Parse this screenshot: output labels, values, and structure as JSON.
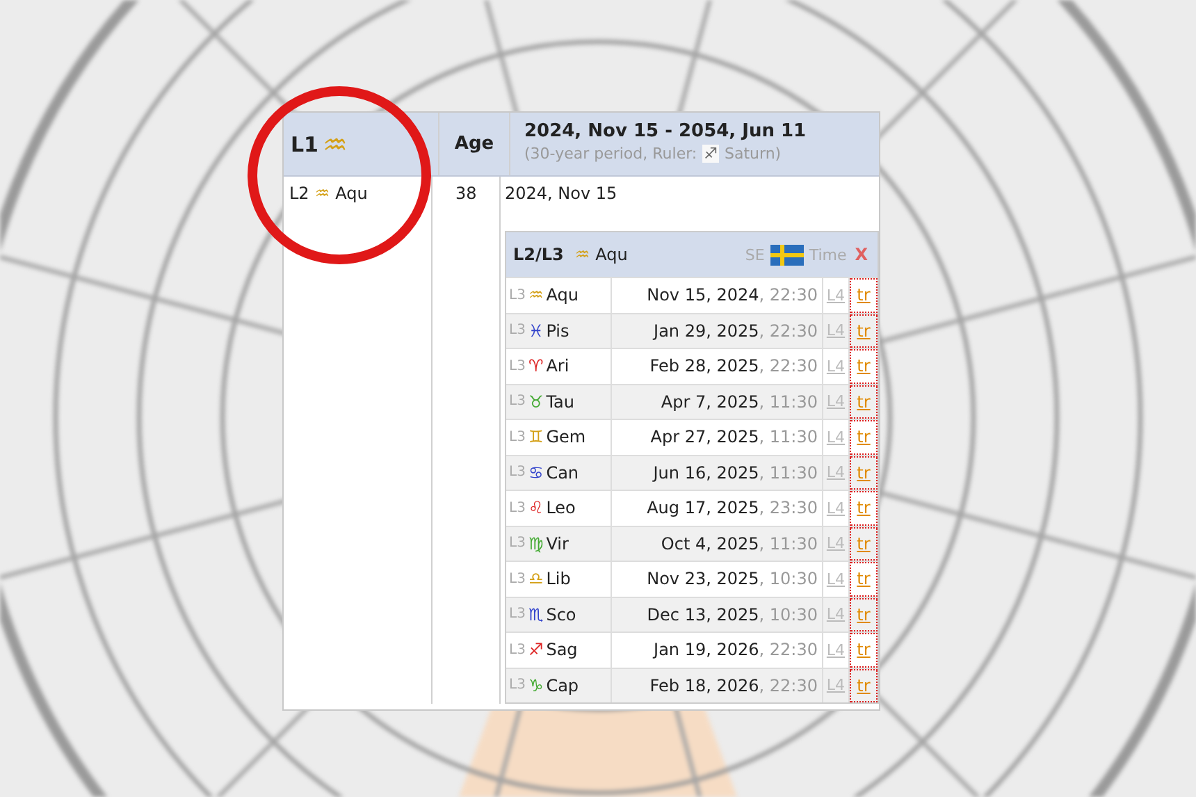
{
  "header": {
    "level_label": "L1",
    "level_glyph": "♒",
    "age_label": "Age",
    "period": "2024, Nov 15 - 2054, Jun 11",
    "period_note": "(30-year period, Ruler:",
    "ruler_glyph": "♐",
    "ruler_name": "Saturn)"
  },
  "row": {
    "level_label": "L2",
    "glyph": "♒",
    "sign": "Aqu",
    "age": "38",
    "start": "2024, Nov 15"
  },
  "subtable": {
    "title": "L2/L3",
    "glyph": "♒",
    "sign": "Aqu",
    "country": "SE",
    "time_label": "Time",
    "close": "X",
    "rows": [
      {
        "level": "L3",
        "glyph": "♒",
        "sign": "Aqu",
        "color": "#d4a017",
        "date": "Nov 15, 2024",
        "time": ", 22:30",
        "link": "L4",
        "tr": "tr"
      },
      {
        "level": "L3",
        "glyph": "♓",
        "sign": "Pis",
        "color": "#3344cc",
        "date": "Jan 29, 2025",
        "time": ", 22:30",
        "link": "L4",
        "tr": "tr"
      },
      {
        "level": "L3",
        "glyph": "♈",
        "sign": "Ari",
        "color": "#dd2222",
        "date": "Feb 28, 2025",
        "time": ", 22:30",
        "link": "L4",
        "tr": "tr"
      },
      {
        "level": "L3",
        "glyph": "♉",
        "sign": "Tau",
        "color": "#44aa33",
        "date": "Apr 7, 2025",
        "time": ", 11:30",
        "link": "L4",
        "tr": "tr"
      },
      {
        "level": "L3",
        "glyph": "♊",
        "sign": "Gem",
        "color": "#d4a017",
        "date": "Apr 27, 2025",
        "time": ", 11:30",
        "link": "L4",
        "tr": "tr"
      },
      {
        "level": "L3",
        "glyph": "♋",
        "sign": "Can",
        "color": "#3344cc",
        "date": "Jun 16, 2025",
        "time": ", 11:30",
        "link": "L4",
        "tr": "tr"
      },
      {
        "level": "L3",
        "glyph": "♌",
        "sign": "Leo",
        "color": "#dd2222",
        "date": "Aug 17, 2025",
        "time": ", 23:30",
        "link": "L4",
        "tr": "tr"
      },
      {
        "level": "L3",
        "glyph": "♍",
        "sign": "Vir",
        "color": "#44aa33",
        "date": "Oct 4, 2025",
        "time": ", 11:30",
        "link": "L4",
        "tr": "tr"
      },
      {
        "level": "L3",
        "glyph": "♎",
        "sign": "Lib",
        "color": "#d4a017",
        "date": "Nov 23, 2025",
        "time": ", 10:30",
        "link": "L4",
        "tr": "tr"
      },
      {
        "level": "L3",
        "glyph": "♏",
        "sign": "Sco",
        "color": "#3344cc",
        "date": "Dec 13, 2025",
        "time": ", 10:30",
        "link": "L4",
        "tr": "tr"
      },
      {
        "level": "L3",
        "glyph": "♐",
        "sign": "Sag",
        "color": "#dd2222",
        "date": "Jan 19, 2026",
        "time": ", 22:30",
        "link": "L4",
        "tr": "tr"
      },
      {
        "level": "L3",
        "glyph": "♑",
        "sign": "Cap",
        "color": "#44aa33",
        "date": "Feb 18, 2026",
        "time": ", 22:30",
        "link": "L4",
        "tr": "tr"
      }
    ]
  }
}
